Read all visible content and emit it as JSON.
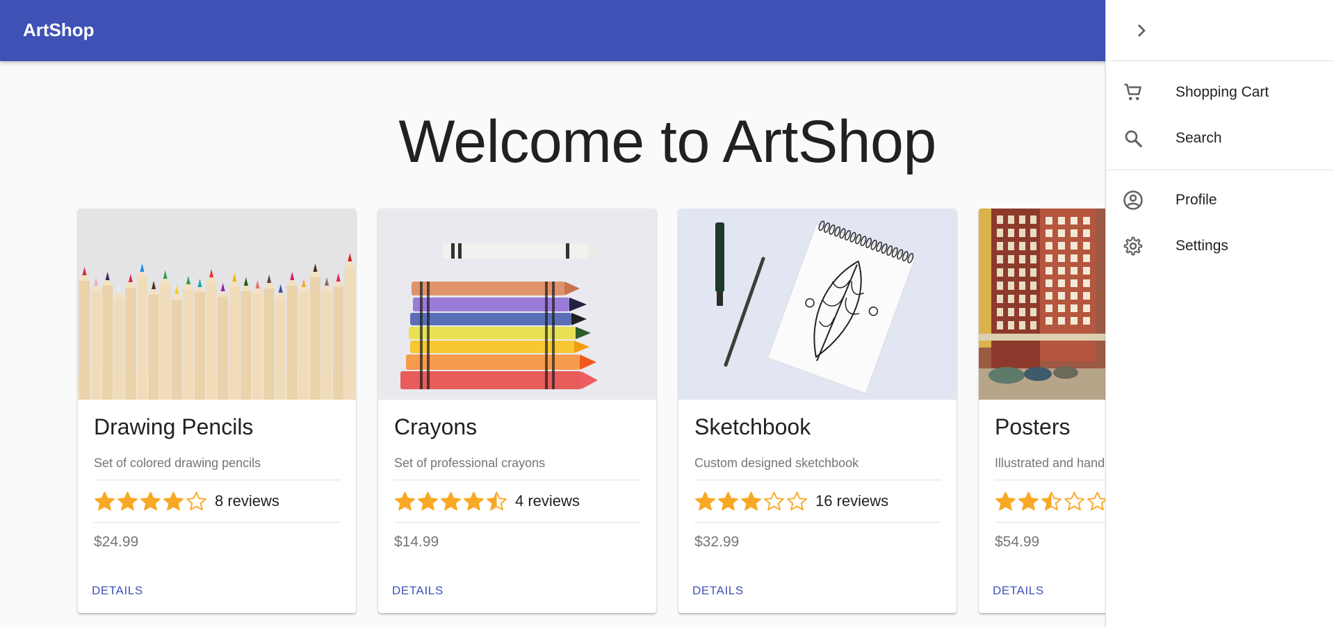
{
  "app": {
    "title": "ArtShop"
  },
  "main": {
    "heading": "Welcome to ArtShop"
  },
  "products": [
    {
      "title": "Drawing Pencils",
      "description": "Set of colored drawing pencils",
      "rating": 4,
      "reviews": "8 reviews",
      "price": "$24.99",
      "action": "DETAILS"
    },
    {
      "title": "Crayons",
      "description": "Set of professional crayons",
      "rating": 4.5,
      "reviews": "4 reviews",
      "price": "$14.99",
      "action": "DETAILS"
    },
    {
      "title": "Sketchbook",
      "description": "Custom designed sketchbook",
      "rating": 3,
      "reviews": "16 reviews",
      "price": "$32.99",
      "action": "DETAILS"
    },
    {
      "title": "Posters",
      "description": "Illustrated and handmade posters",
      "rating": 2.5,
      "reviews": "",
      "price": "$54.99",
      "action": "DETAILS"
    }
  ],
  "drawer": {
    "items": [
      {
        "label": "Shopping Cart",
        "icon": "cart-icon"
      },
      {
        "label": "Search",
        "icon": "search-icon"
      },
      {
        "label": "Profile",
        "icon": "account-circle-icon"
      },
      {
        "label": "Settings",
        "icon": "gear-icon"
      }
    ]
  },
  "colors": {
    "primary": "#3f51b5",
    "star": "#f9a825",
    "background": "#fafafa"
  }
}
